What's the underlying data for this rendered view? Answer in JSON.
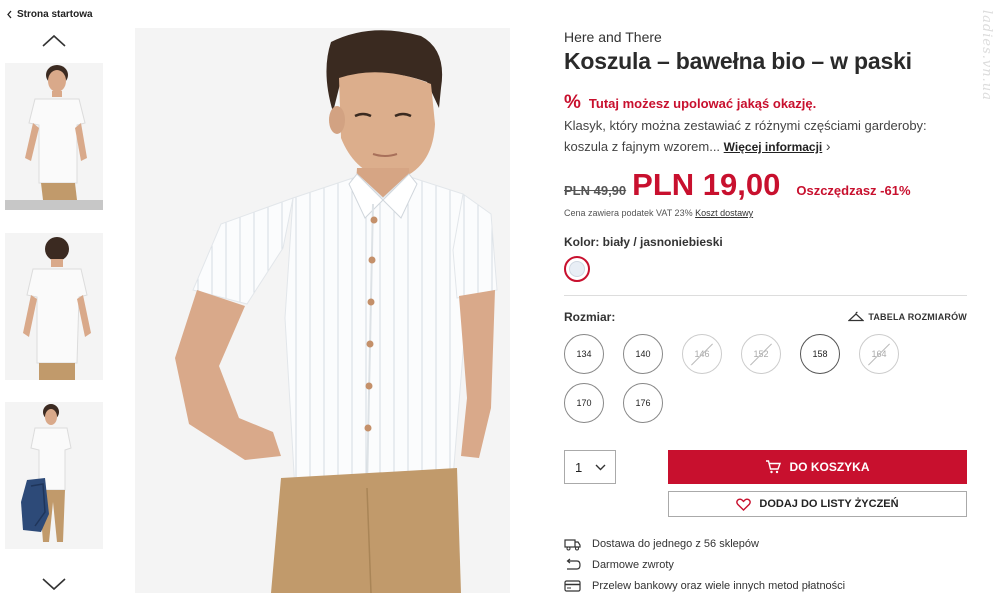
{
  "breadcrumb": {
    "label": "Strona startowa"
  },
  "gallery": {
    "thumbnails": [
      "thumb-1",
      "thumb-2",
      "thumb-3"
    ]
  },
  "product": {
    "brand": "Here and There",
    "title": "Koszula – bawełna bio – w paski",
    "deal_icon": "%",
    "deal_text": "Tutaj możesz upolować jakąś okazję.",
    "description": "Klasyk, który można zestawiać z różnymi częściami garderoby: koszula z fajnym wzorem...",
    "more_info": "Więcej informacji",
    "old_price": "PLN 49,90",
    "new_price": "PLN 19,00",
    "savings": "Oszczędzasz -61%",
    "vat_text": "Cena zawiera podatek VAT 23%",
    "shipping_link": "Koszt dostawy",
    "color_label": "Kolor: biały / jasnoniebieski",
    "size_label": "Rozmiar:",
    "size_table": "TABELA ROZMIARÓW",
    "sizes": [
      {
        "value": "134",
        "available": true
      },
      {
        "value": "140",
        "available": true
      },
      {
        "value": "146",
        "available": false
      },
      {
        "value": "152",
        "available": false
      },
      {
        "value": "158",
        "available": true,
        "selected": true
      },
      {
        "value": "164",
        "available": false
      },
      {
        "value": "170",
        "available": true
      },
      {
        "value": "176",
        "available": true
      }
    ],
    "quantity": "1",
    "add_to_cart": "DO KOSZYKA",
    "add_to_wishlist": "DODAJ DO LISTY ŻYCZEŃ"
  },
  "perks": [
    {
      "icon": "truck-icon",
      "text": "Dostawa do jednego z 56 sklepów"
    },
    {
      "icon": "return-icon",
      "text": "Darmowe zwroty"
    },
    {
      "icon": "card-icon",
      "text": "Przelew bankowy oraz wiele innych metod płatności"
    }
  ],
  "colors": {
    "accent": "#c8102e",
    "text": "#222222"
  }
}
